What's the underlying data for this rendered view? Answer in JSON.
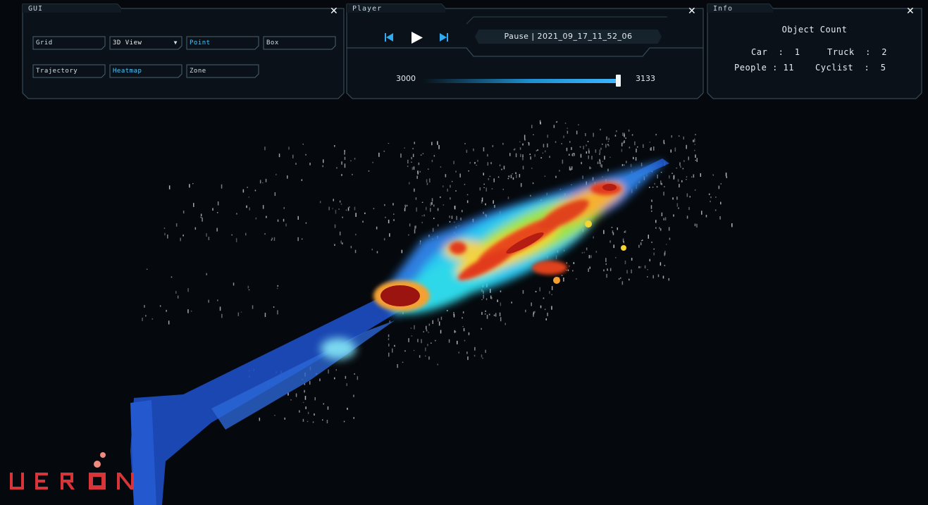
{
  "gui": {
    "title": "GUI",
    "close_icon": "close-icon",
    "buttons": [
      {
        "label": "Grid",
        "active": false
      },
      {
        "label": "3D View",
        "active": true,
        "dropdown": true
      },
      {
        "label": "Point",
        "active": true
      },
      {
        "label": "Box",
        "active": false
      },
      {
        "label": "Trajectory",
        "active": false
      },
      {
        "label": "Heatmap",
        "active": true
      },
      {
        "label": "Zone",
        "active": false
      }
    ]
  },
  "player": {
    "title": "Player",
    "status": "Pause  | 2021_09_17_11_52_06",
    "range_start": "3000",
    "range_end": "3133",
    "progress": 1.0,
    "icons": [
      "skip-back-icon",
      "play-icon",
      "skip-forward-icon",
      "close-icon"
    ]
  },
  "info": {
    "title": "Info",
    "heading": "Object Count",
    "counts": {
      "car": "Car  :  1",
      "truck": "Truck  :  2",
      "people": "People : 11",
      "cyclist": "Cyclist  :  5"
    }
  },
  "logo": {
    "text": "UERON",
    "color": "#d8353a",
    "dot_color": "#f08a80"
  },
  "colors": {
    "background": "#05080c",
    "panel_border": "#3d5663",
    "accent": "#3aa8e8",
    "heat_low": "#1a4bc8",
    "heat_mid": "#2ee0ff",
    "heat_high": "#e23a1a",
    "heat_peak": "#9c1410"
  }
}
